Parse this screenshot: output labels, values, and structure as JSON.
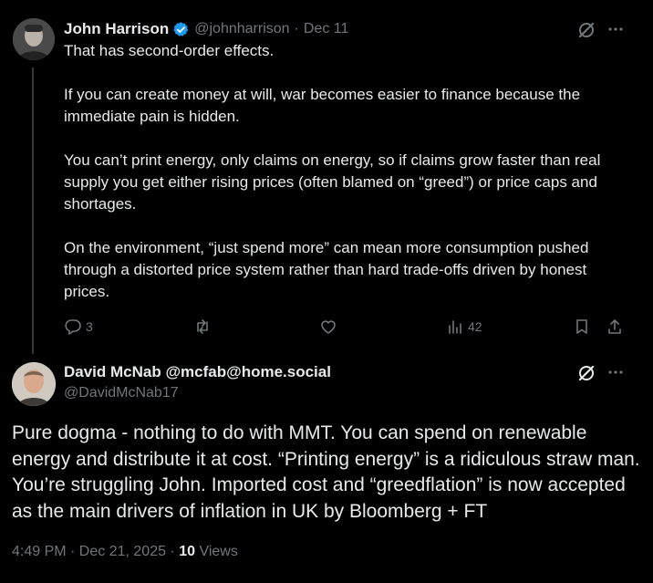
{
  "reply": {
    "author_name": "John Harrison",
    "handle": "@johnharrison",
    "separator": "·",
    "date": "Dec 11",
    "paragraphs": [
      "That has second-order effects.",
      "If you can create money at will, war becomes easier to finance because the immediate pain is hidden.",
      "You can’t print energy, only claims on energy, so if claims grow faster than real supply you get either rising prices (often blamed on “greed”) or price caps and shortages.",
      "On the environment, “just spend more” can mean more consumption pushed through a distorted price system rather than hard trade-offs driven by honest prices."
    ],
    "actions": {
      "reply_count": "3",
      "retweet_count": "",
      "like_count": "",
      "views_count": "42"
    }
  },
  "main_post": {
    "author_name": "David McNab @mcfab@home.social",
    "handle": "@DavidMcNab17",
    "text": "Pure dogma - nothing to do with MMT. You can spend on renewable energy and distribute it at cost. “Printing energy” is a ridiculous straw man. You’re struggling John. Imported cost and “greedflation” is now accepted as the main drivers of inflation in UK by Bloomberg + FT",
    "timestamp": "4:49 PM · Dec 21, 2025 · ",
    "views_count": "10",
    "views_label": " Views"
  },
  "colors": {
    "background": "#000000",
    "text": "#e7e9ea",
    "secondary": "#71767b",
    "verified": "#1d9bf0"
  },
  "icons": [
    "grok-icon",
    "more-icon",
    "reply-icon",
    "retweet-icon",
    "like-icon",
    "views-icon",
    "bookmark-icon",
    "share-icon",
    "verified-badge-icon"
  ]
}
